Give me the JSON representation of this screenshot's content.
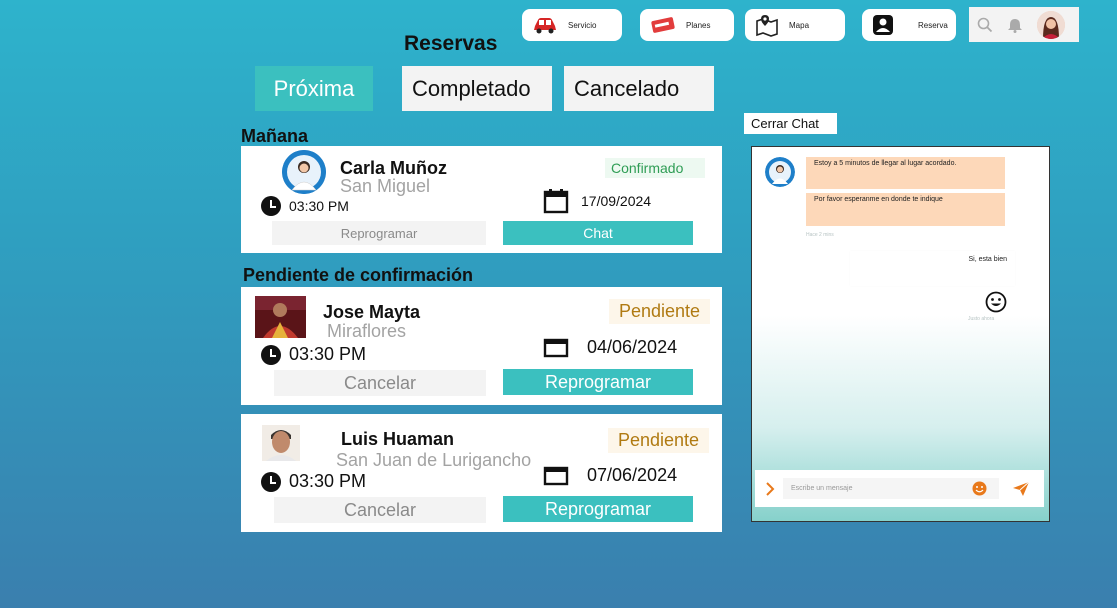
{
  "nav": {
    "servicio": "Servicio",
    "planes": "Planes",
    "mapa": "Mapa",
    "reserva": "Reserva"
  },
  "page_title": "Reservas",
  "tabs": [
    "Próxima",
    "Completado",
    "Cancelado"
  ],
  "sections": {
    "tomorrow": "Mañana",
    "pending": "Pendiente de confirmación"
  },
  "bookings": [
    {
      "name": "Carla Muñoz",
      "place": "San Miguel",
      "status": "Confirmado",
      "time": "03:30 PM",
      "date": "17/09/2024",
      "secondary_action": "Reprogramar",
      "primary_action": "Chat"
    },
    {
      "name": "Jose Mayta",
      "place": "Miraflores",
      "status": "Pendiente",
      "time": "03:30 PM",
      "date": "04/06/2024",
      "secondary_action": "Cancelar",
      "primary_action": "Reprogramar"
    },
    {
      "name": "Luis Huaman",
      "place": "San Juan de Lurigancho",
      "status": "Pendiente",
      "time": "03:30 PM",
      "date": "07/06/2024",
      "secondary_action": "Cancelar",
      "primary_action": "Reprogramar"
    }
  ],
  "chat": {
    "close_label": "Cerrar Chat",
    "messages_in": [
      "Estoy a 5 minutos de llegar al lugar acordado.",
      "Por favor esperanme en donde te indique"
    ],
    "in_timestamp": "Hace 2 mins",
    "message_out": "Si, esta bien",
    "out_timestamp": "Justo ahora",
    "input_placeholder": "Escribe un mensaje"
  },
  "colors": {
    "accent": "#3bc0bf",
    "confirmed": "#2f9d55",
    "pending": "#b07a12",
    "bubble_in": "#fdd8b9"
  }
}
